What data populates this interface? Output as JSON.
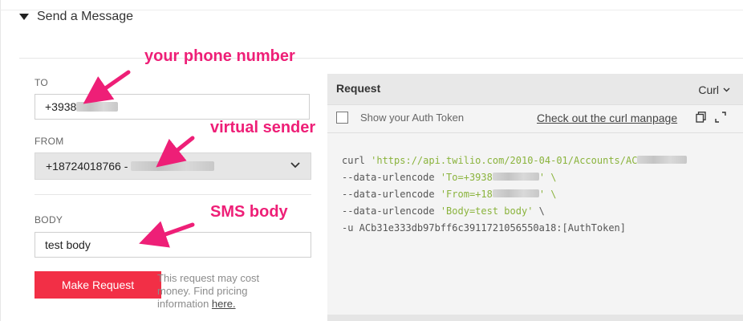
{
  "section": {
    "title": "Send a Message"
  },
  "form": {
    "to": {
      "label": "TO",
      "value": "+3938"
    },
    "from": {
      "label": "FROM",
      "value": "+18724018766 - "
    },
    "body": {
      "label": "BODY",
      "value": "test body"
    },
    "submit_label": "Make Request",
    "cost_note": "This request may cost money. Find pricing information ",
    "cost_link": "here."
  },
  "request": {
    "title": "Request",
    "language": "Curl",
    "show_auth_label": "Show your Auth Token",
    "manpage_link": "Check out the curl manpage",
    "code": {
      "l1_cmd": "curl ",
      "l1_url": "'https://api.twilio.com/2010-04-01/Accounts/AC",
      "l2_flag": "--data-urlencode ",
      "l2_str": "'To=+3938",
      "l2_end": "' \\",
      "l3_flag": "--data-urlencode ",
      "l3_str": "'From=+18",
      "l3_end": "' \\",
      "l4_flag": "--data-urlencode ",
      "l4_str": "'Body=test body'",
      "l4_end": " \\",
      "l5": "-u ACb31e333db97bff6c3911721056550a18:[AuthToken]"
    }
  },
  "annotations": {
    "phone": "your phone number",
    "sender": "virtual sender",
    "sms": "SMS body"
  },
  "colors": {
    "brand_red": "#f22f46",
    "annotation_pink": "#ee1f77",
    "code_string": "#8ab33c"
  }
}
